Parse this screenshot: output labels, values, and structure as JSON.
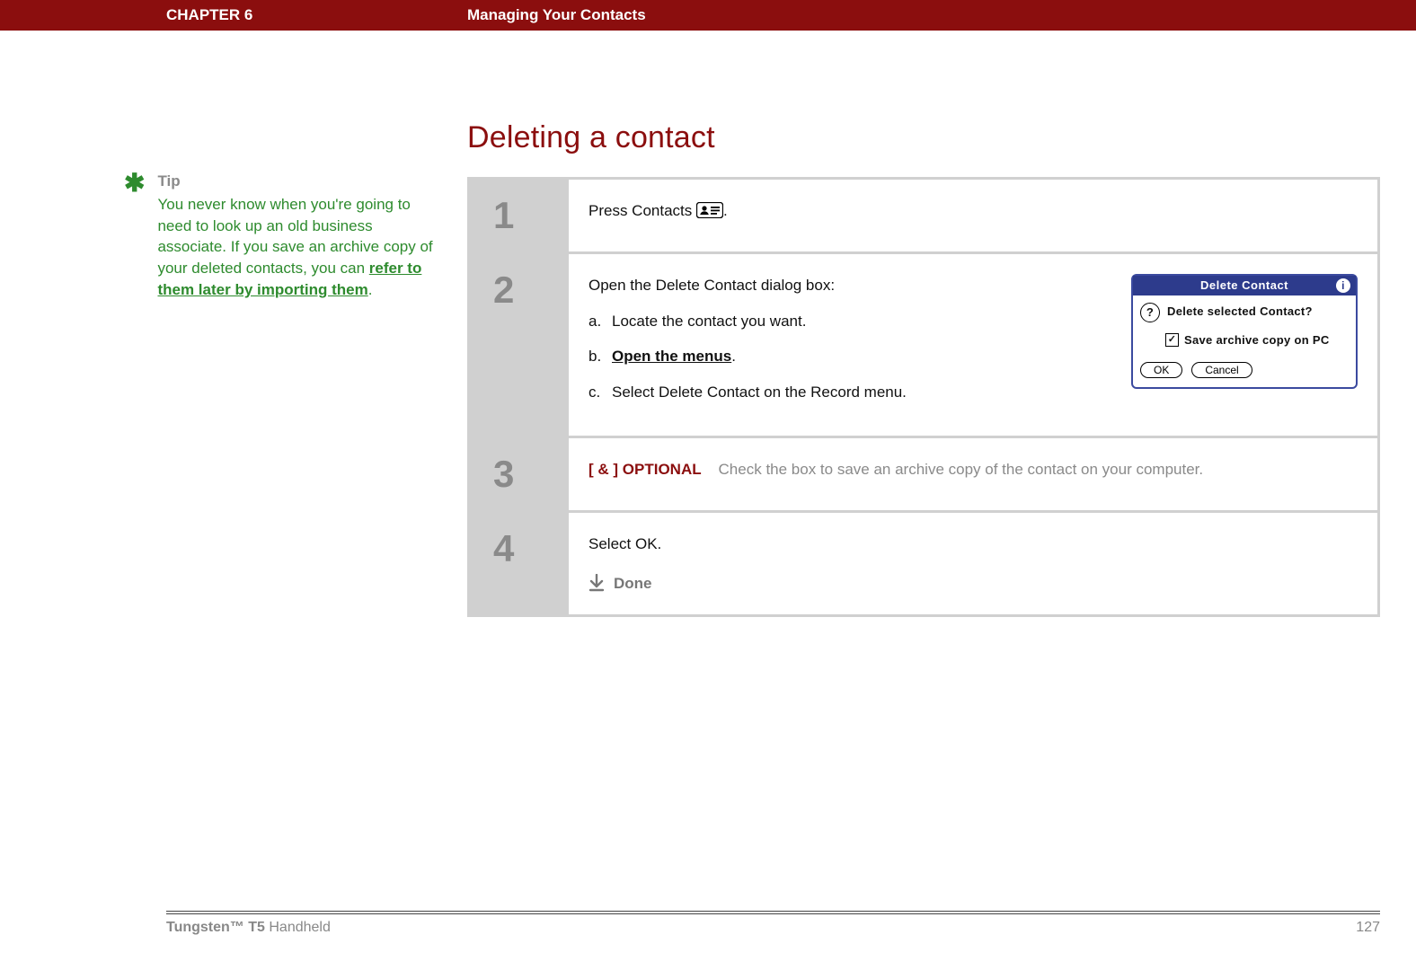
{
  "header": {
    "chapter": "CHAPTER 6",
    "title": "Managing Your Contacts"
  },
  "tip": {
    "heading": "Tip",
    "text_before_link": "You never know when you're going to need to look up an old business associate. If you save an archive copy of your deleted contacts, you can ",
    "link_text": "refer to them later by importing them",
    "text_after_link": "."
  },
  "section_title": "Deleting a contact",
  "steps": [
    {
      "num": "1",
      "text_before_icon": "Press Contacts ",
      "text_after_icon": "."
    },
    {
      "num": "2",
      "intro": "Open the Delete Contact dialog box:",
      "subs": [
        {
          "lbl": "a.",
          "text": "Locate the contact you want."
        },
        {
          "lbl": "b.",
          "link": "Open the menus",
          "suffix": "."
        },
        {
          "lbl": "c.",
          "text": "Select Delete Contact on the Record menu."
        }
      ]
    },
    {
      "num": "3",
      "optional_tag": "[ & ]  OPTIONAL",
      "optional_text": "Check the box to save an archive copy of the contact on your computer."
    },
    {
      "num": "4",
      "text": "Select OK.",
      "done": "Done"
    }
  ],
  "dialog": {
    "title": "Delete Contact",
    "message": "Delete selected Contact?",
    "checkbox_label": "Save archive copy on PC",
    "ok": "OK",
    "cancel": "Cancel"
  },
  "footer": {
    "product_bold": "Tungsten™ T5",
    "product_rest": " Handheld",
    "page_number": "127"
  }
}
